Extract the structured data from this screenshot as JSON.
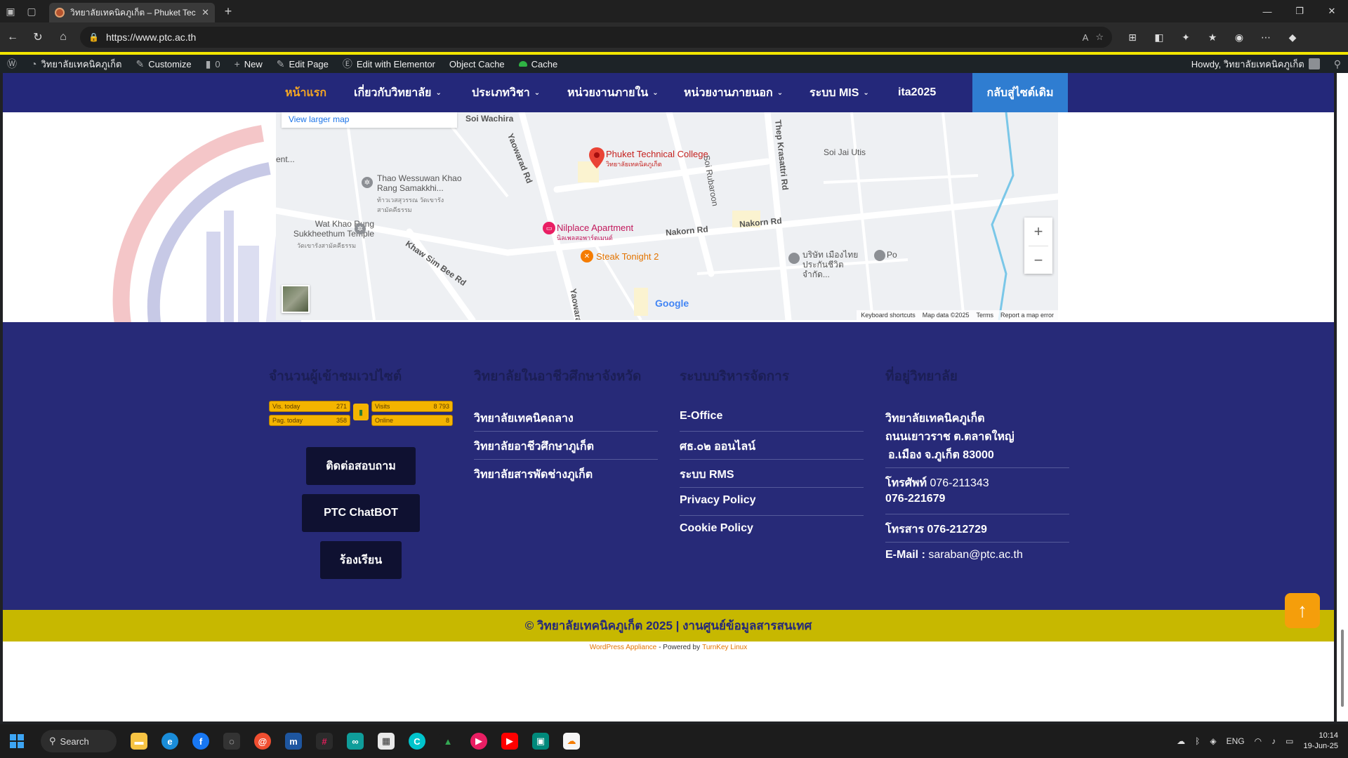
{
  "browser": {
    "tab_title": "วิทยาลัยเทคนิคภูเก็ต – Phuket Techn",
    "url": "https://www.ptc.ac.th",
    "win_minimize": "—",
    "win_restore": "❐",
    "win_close": "✕"
  },
  "adminbar": {
    "site_name": "วิทยาลัยเทคนิคภูเก็ต",
    "customize": "Customize",
    "comments_count": "0",
    "new": "New",
    "edit_page": "Edit Page",
    "edit_elementor": "Edit with Elementor",
    "object_cache": "Object Cache",
    "cache": "Cache",
    "howdy": "Howdy, วิทยาลัยเทคนิคภูเก็ต"
  },
  "mainnav": {
    "items": [
      {
        "label": "หน้าแรก"
      },
      {
        "label": "เกี่ยวกับวิทยาลัย"
      },
      {
        "label": "ประเภทวิชา"
      },
      {
        "label": "หน่วยงานภายใน"
      },
      {
        "label": "หน่วยงานภายนอก"
      },
      {
        "label": "ระบบ MIS"
      },
      {
        "label": "ita2025"
      }
    ],
    "back_button": "กลับสู่ไซต์เดิม"
  },
  "map": {
    "view_larger": "View larger map",
    "labels": {
      "ptc": "Phuket Technical College",
      "ptc_th": "วิทยาลัยเทคนิคภูเก็ต",
      "nilplace": "Nilplace Apartment",
      "nilplace_th": "นิลเพลสอพาร์ตเมนต์",
      "steak": "Steak Tonight 2",
      "wessuwan": "Thao Wessuwan Khao Rang Samakkhi...",
      "wessuwan_th": "ท้าวเวสสุวรรณ วัดเขารังสามัคคีธรรม",
      "wat": "Wat Khao Rung Sukkheethum Temple",
      "wat_th": "วัดเขารังสามัคคีธรรม",
      "ent": "ent...",
      "soi_wachira": "Soi Wachira",
      "yaowarad": "Yaowarad Rd",
      "yaowara": "Yaowara",
      "soi_rubaroon": "Soi Rubaroon",
      "soi_jai_utis": "Soi Jai Utis",
      "thep_krasattri": "Thep Krasattri Rd",
      "nakorn1": "Nakorn Rd",
      "nakorn2": "Nakorn Rd",
      "khaw_sim_bee": "Khaw Sim Bee Rd",
      "insurance": "บริษัท เมืองไทยประกันชีวิต จำกัด...",
      "po": "Po",
      "google": "Google"
    },
    "footer": {
      "keyboard": "Keyboard shortcuts",
      "mapdata": "Map data ©2025",
      "terms": "Terms",
      "report": "Report a map error"
    }
  },
  "footer": {
    "col1_title": "จำนวนผู้เข้าชมเวปไซต์",
    "counter": {
      "vis_today_label": "Vis. today",
      "vis_today": "271",
      "pag_today_label": "Pag. today",
      "pag_today": "358",
      "visits_label": "Visits",
      "visits": "8 793",
      "online_label": "Online",
      "online": "8"
    },
    "buttons": [
      "ติดต่อสอบถาม",
      "PTC ChatBOT",
      "ร้องเรียน"
    ],
    "col2_title": "วิทยาลัยในอาชีวศึกษาจังหวัด",
    "col2_links": [
      "วิทยาลัยเทคนิคถลาง",
      "วิทยาลัยอาชีวศึกษาภูเก็ต",
      "วิทยาลัยสารพัดช่างภูเก็ต"
    ],
    "col3_title": "ระบบบริหารจัดการ",
    "col3_links": [
      "E-Office",
      "ศธ.๐๒ ออนไลน์",
      "ระบบ RMS",
      "Privacy Policy",
      "Cookie Policy"
    ],
    "col4_title": "ที่อยู่วิทยาลัย",
    "address": {
      "line1": "วิทยาลัยเทคนิคภูเก็ต",
      "line2": "ถนนเยาวราช ต.ตลาดใหญ่",
      "line3": "อ.เมือง จ.ภูเก็ต 83000",
      "phone_label": "โทรศัพท์",
      "phone1": "076-211343",
      "phone2": "076-221679",
      "fax_label": "โทรสาร",
      "fax": "076-212729",
      "email_label": "E-Mail :",
      "email": "saraban@ptc.ac.th"
    }
  },
  "copyright": "© วิทยาลัยเทคนิคภูเก็ต 2025 | งานศูนย์ข้อมูลสารสนเทศ",
  "powered": {
    "appliance": "WordPress Appliance",
    "by": "- Powered by",
    "turnkey": "TurnKey Linux"
  },
  "taskbar": {
    "search": "Search",
    "lang": "ENG",
    "time": "10:14",
    "date": "19-Jun-25"
  },
  "colors": {
    "nav_bg": "#24287a",
    "nav_active": "#f5a623",
    "back_button": "#2f7dd1",
    "footer_bg": "#272a78",
    "copyright_bg": "#c7b800",
    "to_top": "#f59e0b"
  }
}
